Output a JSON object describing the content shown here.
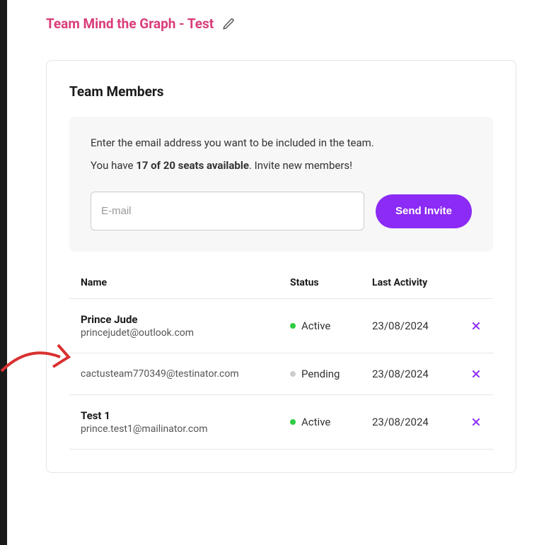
{
  "page": {
    "title": "Team Mind the Graph - Test"
  },
  "teamMembers": {
    "sectionTitle": "Team Members",
    "inviteBox": {
      "instruction": "Enter the email address you want to be included in the team.",
      "seatsPrefix": "You have ",
      "seatsBold": "17 of 20 seats available",
      "seatsSuffix": ". Invite new members!",
      "emailPlaceholder": "E-mail",
      "sendButtonLabel": "Send Invite"
    },
    "table": {
      "headers": {
        "name": "Name",
        "status": "Status",
        "lastActivity": "Last Activity"
      },
      "rows": [
        {
          "name": "Prince Jude",
          "email": "princejudet@outlook.com",
          "status": "Active",
          "statusType": "active",
          "lastActivity": "23/08/2024"
        },
        {
          "name": "",
          "email": "cactusteam770349@testinator.com",
          "status": "Pending",
          "statusType": "pending",
          "lastActivity": "23/08/2024"
        },
        {
          "name": "Test 1",
          "email": "prince.test1@mailinator.com",
          "status": "Active",
          "statusType": "active",
          "lastActivity": "23/08/2024"
        }
      ]
    }
  }
}
